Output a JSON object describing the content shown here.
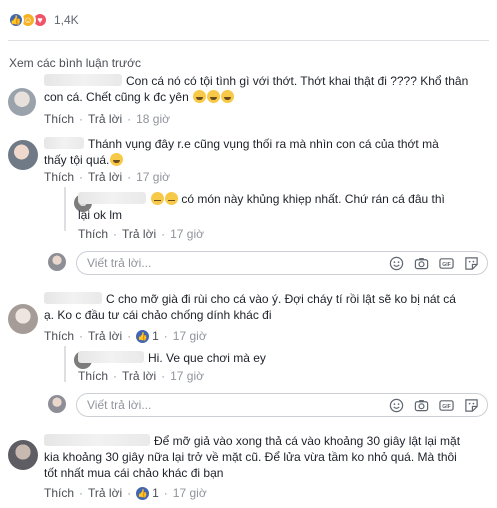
{
  "reactions": {
    "count": "1,4K",
    "icons": [
      "like-icon",
      "haha-icon",
      "love-icon"
    ]
  },
  "view_previous": "Xem các bình luận trước",
  "actions": {
    "like": "Thích",
    "reply": "Trả lời"
  },
  "reply_placeholder": "Viết trả lời...",
  "comments": [
    {
      "text_line1": "Con cá nó có tội tình gì với thớt. Thớt khai thật đi ???? Khổ thân",
      "text_line2": "con cá. Chết cũng k đc yên",
      "time": "18 giờ"
    },
    {
      "text_line1": "Thánh vụng đây r.e cũng vụng thối ra mà nhìn con cá của thớt mà",
      "text_line2": "thấy tội quá.",
      "time": "17 giờ"
    },
    {
      "text_line1": "có món này khủng khiẹp nhất. Chứ rán cá đâu thì",
      "text_line2": "lại ok lm",
      "time": "17 giờ"
    },
    {
      "text_line1": "C cho mỡ già đi rùi cho cá vào ý. Đợi cháy tí rồi lật sẽ ko bị nát cá",
      "text_line2": "ạ. Ko c đầu tư cái chảo chống dính khác đi",
      "likes": "1",
      "time": "17 giờ"
    },
    {
      "text_line1": "Hi. Ve que chơi mà ey",
      "time": "17 giờ"
    },
    {
      "text_line1": "Để mỡ giả vào xong thả cá vào khoảng 30 giây lật lại mặt",
      "text_line2": "kia khoảng 30 giây nữa lại trở về mặt cũ. Để lửa vừa tầm ko nhỏ quá. Mà thôi",
      "text_line3": "tốt nhất mua cái chảo khác đi bạn",
      "likes": "1",
      "time": "17 giờ"
    }
  ]
}
